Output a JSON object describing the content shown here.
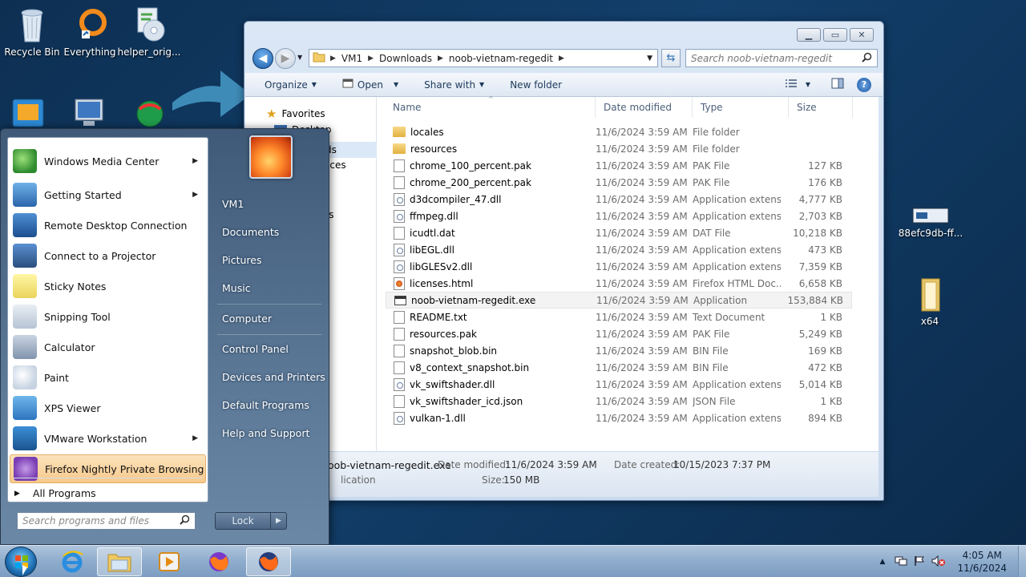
{
  "desktop": {
    "icons": [
      {
        "label": "Recycle Bin"
      },
      {
        "label": "Everything"
      },
      {
        "label": "helper_orig..."
      },
      {
        "label": "88efc9db-ff..."
      },
      {
        "label": "x64"
      }
    ]
  },
  "explorer": {
    "breadcrumb": [
      "VM1",
      "Downloads",
      "noob-vietnam-regedit"
    ],
    "search_placeholder": "Search noob-vietnam-regedit",
    "toolbar": {
      "organize": "Organize",
      "open": "Open",
      "share_with": "Share with",
      "new_folder": "New folder"
    },
    "nav": {
      "favorites": "Favorites",
      "desktop": "Desktop",
      "downloads_partial": "ds",
      "places_partial": "aces",
      "documents_partial": "nts"
    },
    "columns": {
      "name": "Name",
      "date": "Date modified",
      "type": "Type",
      "size": "Size"
    },
    "files": [
      {
        "name": "locales",
        "date": "11/6/2024 3:59 AM",
        "type": "File folder",
        "size": "",
        "icon": "folder"
      },
      {
        "name": "resources",
        "date": "11/6/2024 3:59 AM",
        "type": "File folder",
        "size": "",
        "icon": "folder"
      },
      {
        "name": "chrome_100_percent.pak",
        "date": "11/6/2024 3:59 AM",
        "type": "PAK File",
        "size": "127 KB",
        "icon": "doc"
      },
      {
        "name": "chrome_200_percent.pak",
        "date": "11/6/2024 3:59 AM",
        "type": "PAK File",
        "size": "176 KB",
        "icon": "doc"
      },
      {
        "name": "d3dcompiler_47.dll",
        "date": "11/6/2024 3:59 AM",
        "type": "Application extens...",
        "size": "4,777 KB",
        "icon": "dll"
      },
      {
        "name": "ffmpeg.dll",
        "date": "11/6/2024 3:59 AM",
        "type": "Application extens...",
        "size": "2,703 KB",
        "icon": "dll"
      },
      {
        "name": "icudtl.dat",
        "date": "11/6/2024 3:59 AM",
        "type": "DAT File",
        "size": "10,218 KB",
        "icon": "doc"
      },
      {
        "name": "libEGL.dll",
        "date": "11/6/2024 3:59 AM",
        "type": "Application extens...",
        "size": "473 KB",
        "icon": "dll"
      },
      {
        "name": "libGLESv2.dll",
        "date": "11/6/2024 3:59 AM",
        "type": "Application extens...",
        "size": "7,359 KB",
        "icon": "dll"
      },
      {
        "name": "licenses.html",
        "date": "11/6/2024 3:59 AM",
        "type": "Firefox HTML Doc...",
        "size": "6,658 KB",
        "icon": "html"
      },
      {
        "name": "noob-vietnam-regedit.exe",
        "date": "11/6/2024 3:59 AM",
        "type": "Application",
        "size": "153,884 KB",
        "icon": "exe",
        "selected": true
      },
      {
        "name": "README.txt",
        "date": "11/6/2024 3:59 AM",
        "type": "Text Document",
        "size": "1 KB",
        "icon": "doc"
      },
      {
        "name": "resources.pak",
        "date": "11/6/2024 3:59 AM",
        "type": "PAK File",
        "size": "5,249 KB",
        "icon": "doc"
      },
      {
        "name": "snapshot_blob.bin",
        "date": "11/6/2024 3:59 AM",
        "type": "BIN File",
        "size": "169 KB",
        "icon": "doc"
      },
      {
        "name": "v8_context_snapshot.bin",
        "date": "11/6/2024 3:59 AM",
        "type": "BIN File",
        "size": "472 KB",
        "icon": "doc"
      },
      {
        "name": "vk_swiftshader.dll",
        "date": "11/6/2024 3:59 AM",
        "type": "Application extens...",
        "size": "5,014 KB",
        "icon": "dll"
      },
      {
        "name": "vk_swiftshader_icd.json",
        "date": "11/6/2024 3:59 AM",
        "type": "JSON File",
        "size": "1 KB",
        "icon": "doc"
      },
      {
        "name": "vulkan-1.dll",
        "date": "11/6/2024 3:59 AM",
        "type": "Application extens...",
        "size": "894 KB",
        "icon": "dll"
      }
    ],
    "details": {
      "name_partial": "oob-vietnam-regedit.exe",
      "type_partial": "lication",
      "date_modified_label": "Date modified:",
      "date_modified": "11/6/2024 3:59 AM",
      "date_created_label": "Date created:",
      "date_created": "10/15/2023 7:37 PM",
      "size_label": "Size:",
      "size": "150 MB"
    }
  },
  "start_menu": {
    "programs": [
      {
        "label": "Windows Media Center",
        "submenu": true
      },
      {
        "label": "Getting Started",
        "submenu": true
      },
      {
        "label": "Remote Desktop Connection",
        "submenu": false
      },
      {
        "label": "Connect to a Projector",
        "submenu": false
      },
      {
        "label": "Sticky Notes",
        "submenu": false
      },
      {
        "label": "Snipping Tool",
        "submenu": false
      },
      {
        "label": "Calculator",
        "submenu": false
      },
      {
        "label": "Paint",
        "submenu": false
      },
      {
        "label": "XPS Viewer",
        "submenu": false
      },
      {
        "label": "VMware Workstation",
        "submenu": true
      },
      {
        "label": "Firefox Nightly Private Browsing",
        "submenu": false
      }
    ],
    "all_programs": "All Programs",
    "search_placeholder": "Search programs and files",
    "right": [
      "VM1",
      "Documents",
      "Pictures",
      "Music",
      "Computer",
      "Control Panel",
      "Devices and Printers",
      "Default Programs",
      "Help and Support"
    ],
    "lock": "Lock"
  },
  "taskbar": {
    "time": "4:05 AM",
    "date": "11/6/2024"
  }
}
